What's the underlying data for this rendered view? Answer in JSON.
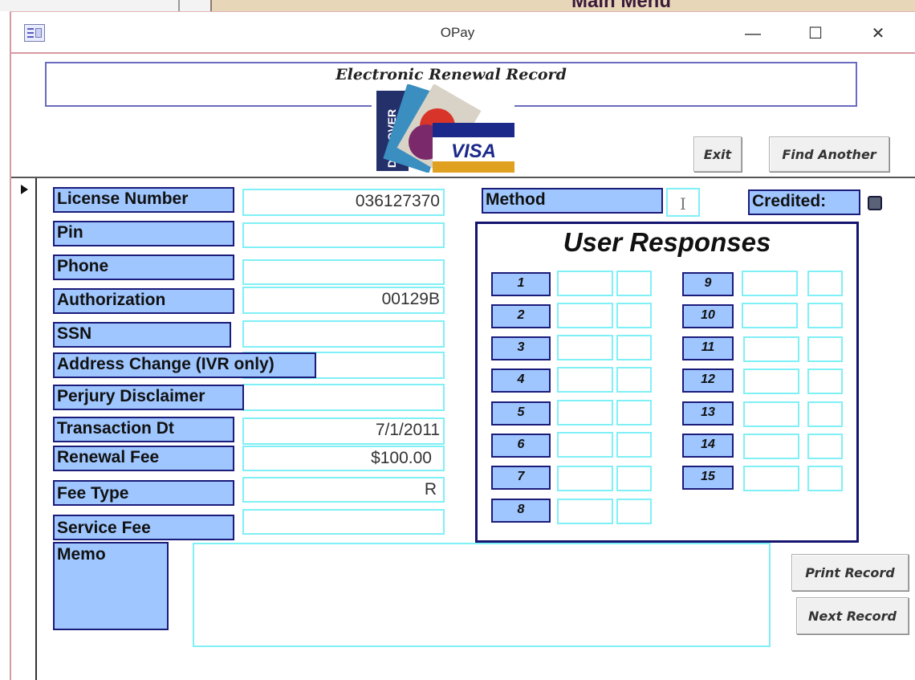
{
  "background_window": {
    "title": "Main Menu"
  },
  "window": {
    "title": "OPay",
    "controls": {
      "minimize": "—",
      "maximize": "☐",
      "close": "✕"
    }
  },
  "header": {
    "title": "Electronic Renewal Record"
  },
  "buttons": {
    "exit": "Exit",
    "find_another": "Find Another",
    "print_record": "Print Record",
    "next_record": "Next Record"
  },
  "cards_logo": {
    "visa": "VISA",
    "discover": "DISCOVER",
    "mastercard": "MasterCard"
  },
  "fields": {
    "license_number": {
      "label": "License Number",
      "value": "036127370"
    },
    "pin": {
      "label": "Pin",
      "value": ""
    },
    "phone": {
      "label": "Phone",
      "value": ""
    },
    "authorization": {
      "label": "Authorization",
      "value": "00129B"
    },
    "ssn": {
      "label": "SSN",
      "value": ""
    },
    "address_change": {
      "label": "Address Change (IVR only)",
      "value": ""
    },
    "perjury_disclaimer": {
      "label": "Perjury Disclaimer",
      "value": ""
    },
    "transaction_dt": {
      "label": "Transaction Dt",
      "value": "7/1/2011"
    },
    "renewal_fee": {
      "label": "Renewal Fee",
      "value": "$100.00"
    },
    "fee_type": {
      "label": "Fee Type",
      "value": "R"
    },
    "service_fee": {
      "label": "Service Fee",
      "value": ""
    },
    "memo": {
      "label": "Memo",
      "value": ""
    }
  },
  "method": {
    "label": "Method",
    "value": "I"
  },
  "credited": {
    "label": "Credited:",
    "checked": true
  },
  "user_responses": {
    "title": "User Responses",
    "items": [
      "1",
      "2",
      "3",
      "4",
      "5",
      "6",
      "7",
      "8",
      "9",
      "10",
      "11",
      "12",
      "13",
      "14",
      "15"
    ]
  }
}
